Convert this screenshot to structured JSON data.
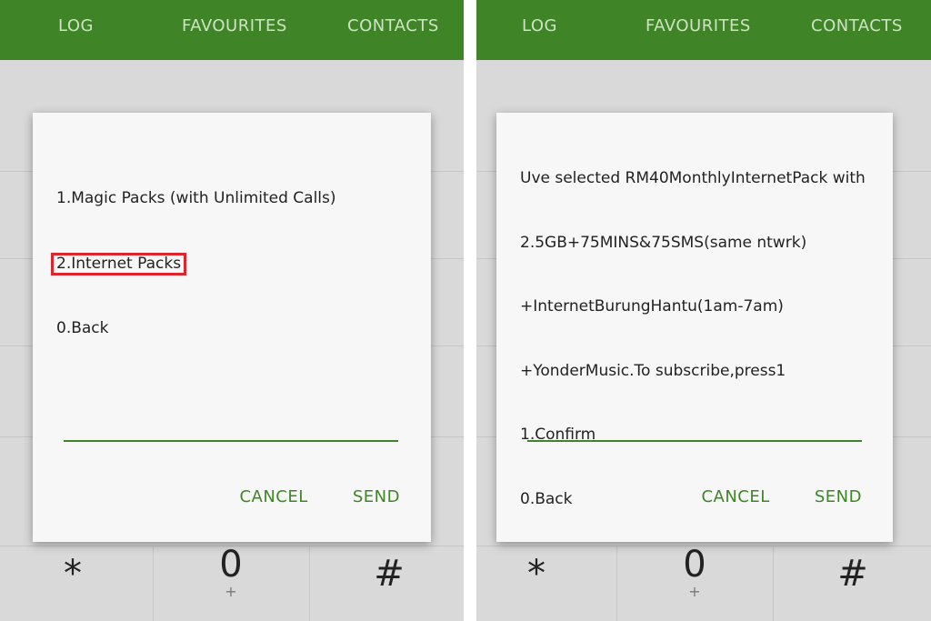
{
  "tabs": [
    "LOG",
    "FAVOURITES",
    "CONTACTS"
  ],
  "keypad": {
    "star": "*",
    "zero": "0",
    "zero_sub": "+",
    "hash": "#"
  },
  "left_dialog": {
    "lines": [
      "1.Magic Packs (with Unlimited Calls)",
      "2.Internet Packs",
      "0.Back"
    ],
    "cancel_label": "CANCEL",
    "send_label": "SEND",
    "highlight_color": "#e0242b"
  },
  "right_dialog": {
    "lines": [
      "Uve selected RM40MonthlyInternetPack with",
      "2.5GB+75MINS&75SMS(same ntwrk)",
      "+InternetBurungHantu(1am-7am)",
      "+YonderMusic.To subscribe,press1",
      "1.Confirm",
      "0.Back"
    ],
    "cancel_label": "CANCEL",
    "send_label": "SEND"
  },
  "colors": {
    "accent": "#3f8527",
    "tab_text": "#cfe3c4",
    "background": "#d9d9d9"
  }
}
